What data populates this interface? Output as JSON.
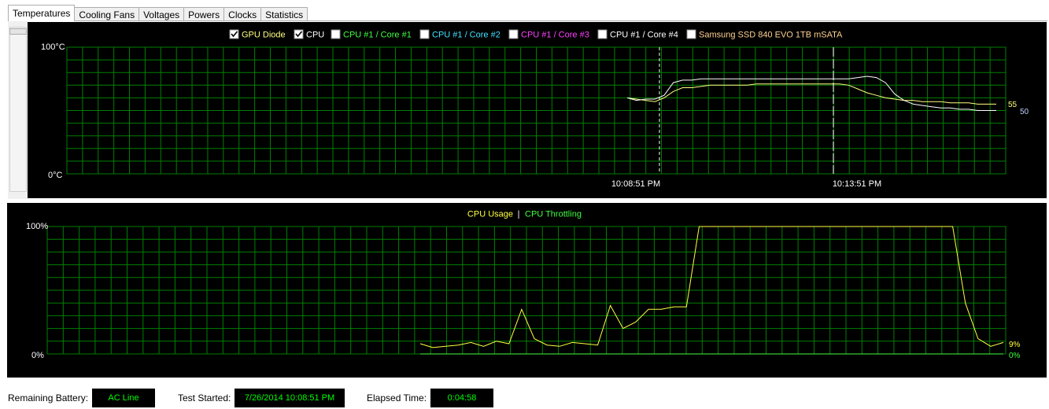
{
  "tabs": [
    "Temperatures",
    "Cooling Fans",
    "Voltages",
    "Powers",
    "Clocks",
    "Statistics"
  ],
  "active_tab": "Temperatures",
  "temp_chart": {
    "legend": [
      {
        "label": "GPU Diode",
        "checked": true,
        "color": "#ffff80"
      },
      {
        "label": "CPU",
        "checked": true,
        "color": "#ffffff"
      },
      {
        "label": "CPU #1 / Core #1",
        "checked": false,
        "color": "#40ff40"
      },
      {
        "label": "CPU #1 / Core #2",
        "checked": false,
        "color": "#40e0ff"
      },
      {
        "label": "CPU #1 / Core #3",
        "checked": false,
        "color": "#ff40ff"
      },
      {
        "label": "CPU #1 / Core #4",
        "checked": false,
        "color": "#ffffff"
      },
      {
        "label": "Samsung SSD 840 EVO 1TB mSATA",
        "checked": false,
        "color": "#ffd090"
      }
    ],
    "y_max_label": "100°C",
    "y_min_label": "0°C",
    "time_labels": [
      "10:08:51 PM",
      "10:13:51 PM"
    ],
    "current_values": [
      {
        "series": "GPU Diode",
        "label": "55"
      },
      {
        "series": "CPU",
        "label": "50"
      }
    ]
  },
  "usage_chart": {
    "legend": [
      {
        "label": "CPU Usage",
        "color": "#ffff40"
      },
      {
        "label": "CPU Throttling",
        "color": "#40ff40"
      }
    ],
    "legend_sep": "|",
    "y_max_label": "100%",
    "y_min_label": "0%",
    "current_values": [
      {
        "series": "CPU Usage",
        "label": "9%"
      },
      {
        "series": "CPU Throttling",
        "label": "0%"
      }
    ]
  },
  "status": {
    "battery_label": "Remaining Battery:",
    "battery_value": "AC Line",
    "test_started_label": "Test Started:",
    "test_started_value": "7/26/2014 10:08:51 PM",
    "elapsed_label": "Elapsed Time:",
    "elapsed_value": "0:04:58"
  },
  "colors": {
    "grid": "#008000",
    "gpu_line": "#ffff80",
    "cpu_line": "#ffffff",
    "usage_line": "#ffff40",
    "throttle_line": "#40ff40",
    "status_text": "#00ff00"
  },
  "chart_data": [
    {
      "type": "line",
      "title": "",
      "ylim": [
        0,
        100
      ],
      "y_unit": "°C",
      "x_ticks": [
        "10:08:51 PM",
        "10:13:51 PM"
      ],
      "series": [
        {
          "name": "GPU Diode",
          "values": [
            60,
            59,
            58,
            57,
            60,
            65,
            68,
            68,
            69,
            70,
            70,
            70,
            70,
            70,
            71,
            71,
            71,
            71,
            71,
            71,
            71,
            71,
            71,
            71,
            70,
            67,
            64,
            62,
            60,
            59,
            58,
            58,
            57,
            57,
            57,
            56,
            56,
            56,
            55,
            55,
            55
          ]
        },
        {
          "name": "CPU",
          "values": [
            60,
            58,
            59,
            59,
            62,
            72,
            74,
            74,
            75,
            75,
            75,
            75,
            75,
            75,
            75,
            75,
            75,
            75,
            75,
            75,
            75,
            75,
            75,
            75,
            75,
            76,
            77,
            76,
            72,
            63,
            58,
            55,
            54,
            53,
            52,
            52,
            51,
            51,
            50,
            50,
            50
          ]
        }
      ]
    },
    {
      "type": "line",
      "title": "",
      "ylim": [
        0,
        100
      ],
      "y_unit": "%",
      "series": [
        {
          "name": "CPU Usage",
          "values": [
            8,
            5,
            6,
            7,
            9,
            6,
            10,
            8,
            35,
            12,
            7,
            6,
            9,
            8,
            7,
            38,
            20,
            25,
            35,
            35,
            37,
            37,
            100,
            100,
            100,
            100,
            100,
            100,
            100,
            100,
            100,
            100,
            100,
            100,
            100,
            100,
            100,
            100,
            100,
            100,
            100,
            100,
            100,
            40,
            12,
            6,
            9
          ]
        },
        {
          "name": "CPU Throttling",
          "values": [
            0,
            0,
            0,
            0,
            0,
            0,
            0,
            0,
            0,
            0,
            0,
            0,
            0,
            0,
            0,
            0,
            0,
            0,
            0,
            0,
            0,
            0,
            0,
            0,
            0,
            0,
            0,
            0,
            0,
            0,
            0,
            0,
            0,
            0,
            0,
            0,
            0,
            0,
            0,
            0,
            0,
            0,
            0,
            0,
            0,
            0,
            0
          ]
        }
      ]
    }
  ]
}
